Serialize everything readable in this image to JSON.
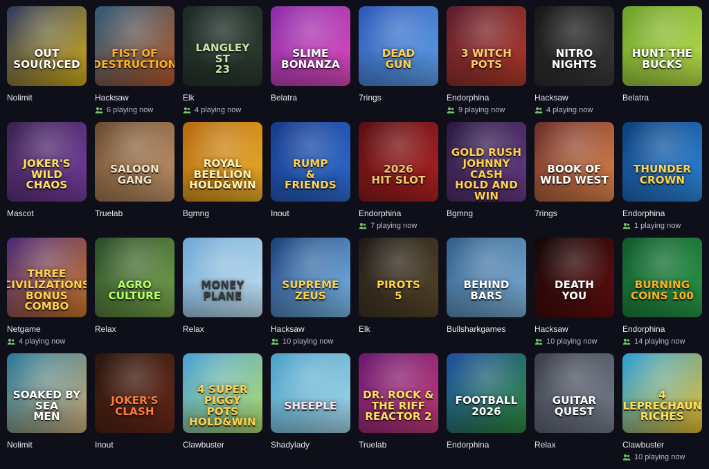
{
  "games": [
    {
      "logo": "OUT\nSOU(R)CED",
      "provider": "Nolimit",
      "players": "",
      "bg": "#2e3a5e",
      "bg2": "#d8b21a",
      "logo_color": "#ffffff"
    },
    {
      "logo": "FIST OF\nDESTRUCTION",
      "provider": "Hacksaw",
      "players": "6 playing now",
      "bg": "#2d5a78",
      "bg2": "#b85b2a",
      "logo_color": "#ffb020"
    },
    {
      "logo": "LANGLEY ST\n23",
      "provider": "Elk",
      "players": "4 playing now",
      "bg": "#1d2a26",
      "bg2": "#2d3b2f",
      "logo_color": "#c6e7a9"
    },
    {
      "logo": "SLIME\nBONANZA",
      "provider": "Belatra",
      "players": "",
      "bg": "#8a2fa9",
      "bg2": "#e04bbf",
      "logo_color": "#ffffff"
    },
    {
      "logo": "DEAD\nGUN",
      "provider": "7rings",
      "players": "",
      "bg": "#2d59b8",
      "bg2": "#5fa2e8",
      "logo_color": "#ffd24a"
    },
    {
      "logo": "3 WITCH\nPOTS",
      "provider": "Endorphina",
      "players": "9 playing now",
      "bg": "#5c1e2d",
      "bg2": "#b53b2a",
      "logo_color": "#ffcc66"
    },
    {
      "logo": "NITRO\nNIGHTS",
      "provider": "Hacksaw",
      "players": "4 playing now",
      "bg": "#181818",
      "bg2": "#3b3b3b",
      "logo_color": "#ffffff"
    },
    {
      "logo": "HUNT the\nBUCKS",
      "provider": "Belatra",
      "players": "",
      "bg": "#6b9f2a",
      "bg2": "#bde14b",
      "logo_color": "#ffffff"
    },
    {
      "logo": "JOKER'S\nWILD\nCHAOS",
      "provider": "Mascot",
      "players": "",
      "bg": "#3a2250",
      "bg2": "#7a3fa3",
      "logo_color": "#ffe05a"
    },
    {
      "logo": "SALOON\nGANG",
      "provider": "Truelab",
      "players": "",
      "bg": "#6a4a30",
      "bg2": "#c79b6b",
      "logo_color": "#f2e1c7"
    },
    {
      "logo": "ROYAL\nBEELLION\nHOLD&WIN",
      "provider": "Bgmng",
      "players": "",
      "bg": "#b56a0f",
      "bg2": "#f0b12a",
      "logo_color": "#fff1b3"
    },
    {
      "logo": "RUMP\n&\nFRIENDS",
      "provider": "Inout",
      "players": "",
      "bg": "#173a8a",
      "bg2": "#2f6fd6",
      "logo_color": "#ffd34a"
    },
    {
      "logo": "2026\nHIT SLOT",
      "provider": "Endorphina",
      "players": "7 playing now",
      "bg": "#5a0f14",
      "bg2": "#b52321",
      "logo_color": "#f3c66c"
    },
    {
      "logo": "GOLD RUSH\nJOHNNY CASH\nHOLD AND WIN",
      "provider": "Bgmng",
      "players": "",
      "bg": "#2a1a40",
      "bg2": "#6b3f8a",
      "logo_color": "#ffd24a"
    },
    {
      "logo": "BOOK OF\nWILD WEST",
      "provider": "7rings",
      "players": "",
      "bg": "#6b2d2a",
      "bg2": "#e38a4b",
      "logo_color": "#ffffff"
    },
    {
      "logo": "THUNDER\nCROWN",
      "provider": "Endorphina",
      "players": "1 playing now",
      "bg": "#0d3e7a",
      "bg2": "#2f8be2",
      "logo_color": "#ffd24a"
    },
    {
      "logo": "THREE\nCIVILIZATIONS\nBONUS COMBO",
      "provider": "Netgame",
      "players": "4 playing now",
      "bg": "#4a2a78",
      "bg2": "#d07a2a",
      "logo_color": "#ffd24a"
    },
    {
      "logo": "AGRO\nCULTURE",
      "provider": "Relax",
      "players": "",
      "bg": "#2a4a2a",
      "bg2": "#7aa84a",
      "logo_color": "#b8ff6b"
    },
    {
      "logo": "MONEY\nPLANE",
      "provider": "Relax",
      "players": "",
      "bg": "#6da7d4",
      "bg2": "#c6e2f2",
      "logo_color": "#3b3b3b"
    },
    {
      "logo": "SUPREME\nZEUS",
      "provider": "Hacksaw",
      "players": "10 playing now",
      "bg": "#1b3e7a",
      "bg2": "#7ec0ef",
      "logo_color": "#ffd24a"
    },
    {
      "logo": "PIROTS\n5",
      "provider": "Elk",
      "players": "",
      "bg": "#1e1a17",
      "bg2": "#5a4a2a",
      "logo_color": "#ffd24a"
    },
    {
      "logo": "BEHIND BARS",
      "provider": "Bullsharkgames",
      "players": "",
      "bg": "#2f5f8a",
      "bg2": "#7fb1d8",
      "logo_color": "#ffffff"
    },
    {
      "logo": "DEATH\nYOU",
      "provider": "Hacksaw",
      "players": "10 playing now",
      "bg": "#120808",
      "bg2": "#6a0e0e",
      "logo_color": "#ffffff"
    },
    {
      "logo": "BURNING\nCOINS 100",
      "provider": "Endorphina",
      "players": "14 playing now",
      "bg": "#0f5a2a",
      "bg2": "#2a9a4a",
      "logo_color": "#ffb020"
    },
    {
      "logo": "SOAKED BY\nSEA\nMEN",
      "provider": "Nolimit",
      "players": "",
      "bg": "#2a7a9a",
      "bg2": "#d0b07a",
      "logo_color": "#ffffff"
    },
    {
      "logo": "JOKER'S\nCLASH",
      "provider": "Inout",
      "players": "",
      "bg": "#2a160e",
      "bg2": "#6a2a18",
      "logo_color": "#ff7a3a"
    },
    {
      "logo": "4 SUPER\nPIGGY\nPOTS\nHOLD&WIN",
      "provider": "Clawbuster",
      "players": "",
      "bg": "#4aa0d8",
      "bg2": "#b7e06b",
      "logo_color": "#ffd24a"
    },
    {
      "logo": "SHEEPLE",
      "provider": "Shadylady",
      "players": "",
      "bg": "#4aa0c8",
      "bg2": "#a7d9ea",
      "logo_color": "#ffe2ef"
    },
    {
      "logo": "DR. ROCK &\nTHE RIFF\nREACTOR 2",
      "provider": "Truelab",
      "players": "",
      "bg": "#6a1a70",
      "bg2": "#c33a7a",
      "logo_color": "#ffe05a"
    },
    {
      "logo": "FOOTBALL\n2026",
      "provider": "Endorphina",
      "players": "",
      "bg": "#1f4fa0",
      "bg2": "#2f8a3a",
      "logo_color": "#ffffff"
    },
    {
      "logo": "GUITAR\nQUEST",
      "provider": "Relax",
      "players": "",
      "bg": "#3a3f4a",
      "bg2": "#7a8190",
      "logo_color": "#ffffff"
    },
    {
      "logo": "4\nLEPRECHAUN\nRICHES",
      "provider": "Clawbuster",
      "players": "10 playing now",
      "bg": "#2aa0d8",
      "bg2": "#f0c02a",
      "logo_color": "#ffe05a"
    }
  ]
}
